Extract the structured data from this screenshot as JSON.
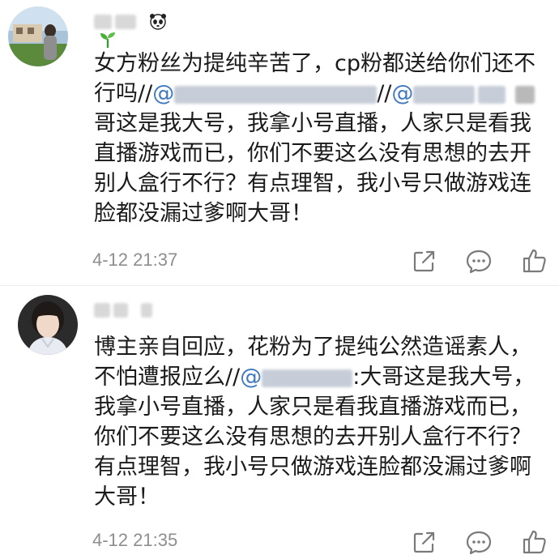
{
  "comments": [
    {
      "username": "",
      "badge_icon": "sprout-icon",
      "text_part1": "女方粉丝为提纯辛苦了，cp粉都送给你们还不行吗//",
      "mention1_prefix": "@",
      "text_part2": "//",
      "mention2_prefix": "@",
      "text_part3": "哥这是我大号，我拿小号直播，人家只是看我直播游戏而已，你们不要这么没有思想的去开别人盒行不行？有点理智，我小号只做游戏连脸都没漏过爹啊大哥！",
      "timestamp": "4-12 21:37",
      "actions": [
        "share-icon",
        "reply-icon",
        "like-icon"
      ]
    },
    {
      "username": "",
      "text_part1": "博主亲自回应，花粉为了提纯公然造谣素人，不怕遭报应么//",
      "mention_prefix": "@",
      "text_part2": ":大哥这是我大号，我拿小号直播，人家只是看我直播游戏而已，你们不要这么没有思想的去开别人盒行不行？有点理智，我小号只做游戏连脸都没漏过爹啊大哥！",
      "timestamp": "4-12 21:35",
      "actions": [
        "share-icon",
        "reply-icon",
        "like-icon"
      ]
    }
  ],
  "colors": {
    "text": "#1a1a1a",
    "mention": "#3f79c0",
    "meta": "#8e8e8e",
    "badge_green": "#3a9a3a"
  }
}
